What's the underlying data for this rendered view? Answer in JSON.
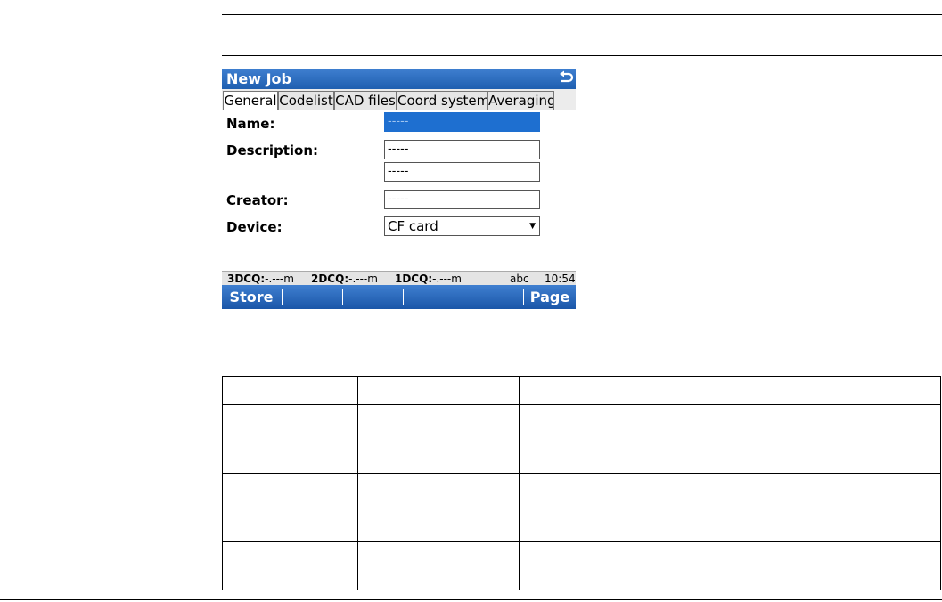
{
  "window": {
    "title": "New Job",
    "back_icon": "back-arrow-icon"
  },
  "tabs": [
    {
      "label": "General",
      "active": true
    },
    {
      "label": "Codelist",
      "active": false
    },
    {
      "label": "CAD files",
      "active": false
    },
    {
      "label": "Coord system",
      "active": false
    },
    {
      "label": "Averaging",
      "active": false
    }
  ],
  "form": {
    "name": {
      "label": "Name:",
      "value": "-----"
    },
    "description": {
      "label": "Description:",
      "value1": "-----",
      "value2": "-----"
    },
    "creator": {
      "label": "Creator:",
      "value": "-----"
    },
    "device": {
      "label": "Device:",
      "value": "CF card"
    }
  },
  "status": {
    "q3d_label": "3DCQ:",
    "q3d_value": "-.---m",
    "q2d_label": "2DCQ:",
    "q2d_value": "-.---m",
    "q1d_label": "1DCQ:",
    "q1d_value": "-.---m",
    "input_mode": "abc",
    "time": "10:54"
  },
  "softkeys": {
    "f1": "Store",
    "f6": "Page"
  },
  "colors": {
    "title_bar": "#1f5fb0",
    "selected_field": "#1e6fd0"
  }
}
